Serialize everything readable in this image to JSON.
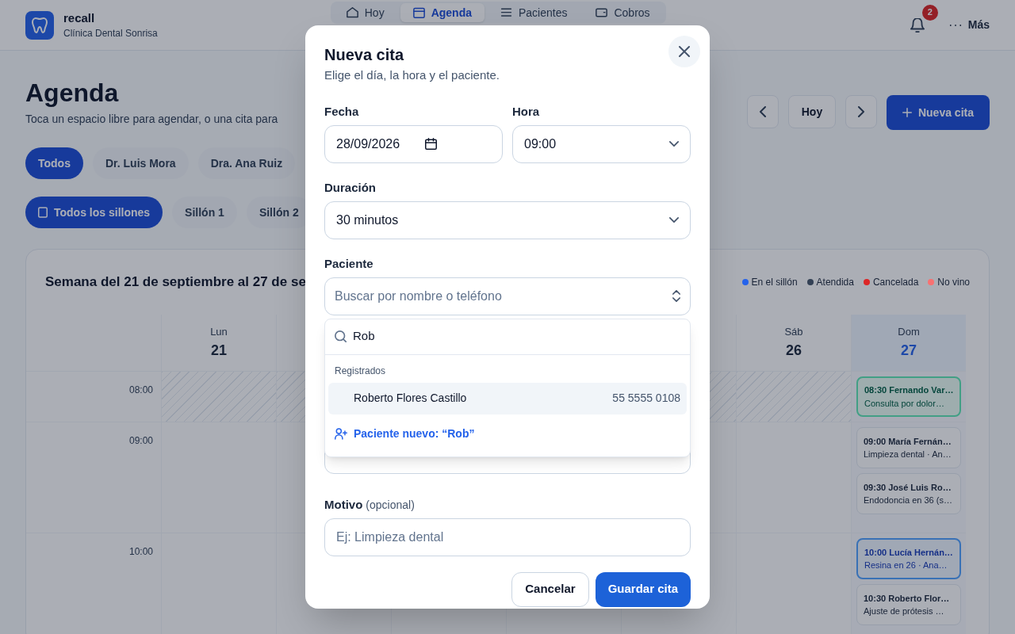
{
  "brand": {
    "name": "recall",
    "subtitle": "Clínica Dental Sonrisa"
  },
  "nav": [
    {
      "label": "Hoy",
      "selected": false
    },
    {
      "label": "Agenda",
      "selected": true
    },
    {
      "label": "Pacientes",
      "selected": false
    },
    {
      "label": "Cobros",
      "selected": false
    }
  ],
  "notifications": {
    "count": "2"
  },
  "more": {
    "label": "Más"
  },
  "page": {
    "title": "Agenda",
    "subtitle": "Toca un espacio libre para agendar, o una cita para"
  },
  "toolbar": {
    "today": "Hoy",
    "new_button": "Nueva cita"
  },
  "doctor_filters": [
    {
      "label": "Todos",
      "selected": true
    },
    {
      "label": "Dr. Luis Mora",
      "selected": false
    },
    {
      "label": "Dra. Ana Ruiz",
      "selected": false
    }
  ],
  "chair_filters": [
    {
      "label": "Todos los sillones",
      "selected": true
    },
    {
      "label": "Sillón 1",
      "selected": false
    },
    {
      "label": "Sillón 2",
      "selected": false
    }
  ],
  "calendar": {
    "title": "Semana del 21 de septiembre al 27 de se",
    "legend": [
      {
        "label": "En el sillón",
        "color": "#2563eb"
      },
      {
        "label": "Atendida",
        "color": "#334155"
      },
      {
        "label": "Cancelada",
        "color": "#dc2626"
      },
      {
        "label": "No vino",
        "color": "#f87171"
      }
    ],
    "hours": [
      "08:00",
      "09:00",
      "10:00"
    ],
    "days": [
      {
        "weekday": "Lun",
        "date": "21",
        "today": false
      },
      {
        "weekday": "Sáb",
        "date": "26",
        "today": false
      },
      {
        "weekday": "Dom",
        "date": "27",
        "today": true,
        "slots": [
          [
            {
              "kind": "done",
              "title": "08:30 Fernando Var…",
              "detail": "Consulta por dolor…"
            }
          ],
          [
            {
              "kind": "plain",
              "title": "09:00 María Fernán…",
              "detail": "Limpieza dental · An…"
            },
            {
              "kind": "plain",
              "title": "09:30 José Luis Ro…",
              "detail": "Endodoncia en 36 (s…"
            }
          ],
          [
            {
              "kind": "chair",
              "title": "10:00 Lucía Hernán…",
              "detail": "Resina en 26 · Ana…"
            },
            {
              "kind": "plain",
              "title": "10:30 Roberto Flor…",
              "detail": "Ajuste de prótesis …"
            }
          ]
        ]
      }
    ]
  },
  "dialog": {
    "title": "Nueva cita",
    "subtitle": "Elige el día, la hora y el paciente.",
    "date": {
      "label": "Fecha",
      "value": "28/09/2026"
    },
    "time": {
      "label": "Hora",
      "value": "09:00"
    },
    "duration": {
      "label": "Duración",
      "value": "30 minutos"
    },
    "patient": {
      "label": "Paciente",
      "placeholder": "Buscar por nombre o teléfono",
      "search": {
        "value": "Rob"
      },
      "group": "Registrados",
      "results": [
        {
          "name": "Roberto Flores Castillo",
          "phone": "55 5555 0108",
          "selected": true
        }
      ],
      "new_patient": "Paciente nuevo: “Rob”"
    },
    "reason": {
      "label": "Motivo",
      "hint": "(opcional)",
      "placeholder": "Ej: Limpieza dental"
    },
    "cancel": "Cancelar",
    "save": "Guardar cita"
  }
}
